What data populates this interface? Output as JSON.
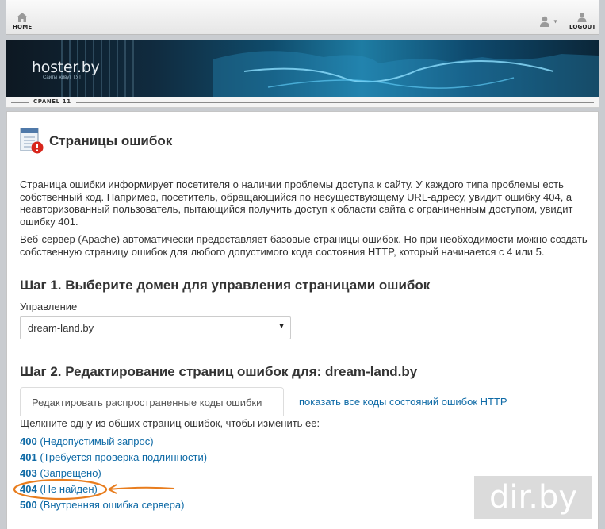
{
  "topbar": {
    "home_label": "HOME",
    "logout_label": "LOGOUT",
    "home_icon": "home-icon",
    "user_icon": "user-icon",
    "logout_icon": "logout-icon"
  },
  "banner": {
    "logo_text": "hoster.by",
    "logo_sub": "Сайты живут ТУТ"
  },
  "strip": {
    "tag": "CPANEL 11"
  },
  "page": {
    "title": "Страницы ошибок",
    "para1": "Страница ошибки информирует посетителя о наличии проблемы доступа к сайту. У каждого типа проблемы есть собственный код. Например, посетитель, обращающийся по несуществующему URL-адресу, увидит ошибку 404, а неавторизованный пользователь, пытающийся получить доступ к области сайта с ограниченным доступом, увидит ошибку 401.",
    "para2": "Веб-сервер (Apache) автоматически предоставляет базовые страницы ошибок. Но при необходимости можно создать собственную страницу ошибок для любого допустимого кода состояния HTTP, который начинается с 4 или 5.",
    "step1": "Шаг 1. Выберите домен для управления страницами ошибок",
    "manage_label": "Управление",
    "domain_selected": "dream-land.by",
    "step2": "Шаг 2. Редактирование страниц ошибок для: dream-land.by",
    "tab1": "Редактировать распространенные коды ошибки",
    "tab2": "показать все коды состояний ошибок HTTP",
    "hint": "Щелкните одну из общих страниц ошибок, чтобы изменить ее:",
    "codes": [
      {
        "code": "400",
        "desc": "(Недопустимый запрос)"
      },
      {
        "code": "401",
        "desc": "(Требуется проверка подлинности)"
      },
      {
        "code": "403",
        "desc": "(Запрещено)"
      },
      {
        "code": "404",
        "desc": "(Не найден)"
      },
      {
        "code": "500",
        "desc": "(Внутренняя ошибка сервера)"
      }
    ]
  },
  "annotation_color": "#e87d1e",
  "watermark": "dir.by"
}
